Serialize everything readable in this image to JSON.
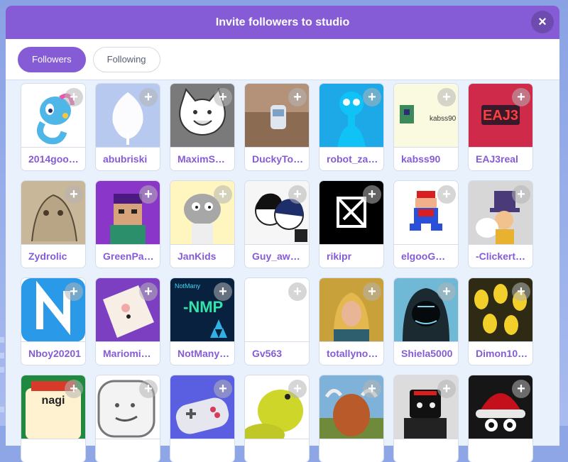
{
  "modal": {
    "title": "Invite followers to studio",
    "close_glyph": "×",
    "tabs": [
      {
        "label": "Followers",
        "active": true
      },
      {
        "label": "Following",
        "active": false
      }
    ]
  },
  "add_glyph": "+",
  "users": [
    {
      "name": "2014goo…",
      "avatar": "seahorse-dragon-icon"
    },
    {
      "name": "abubriski",
      "avatar": "leaf-silhouette-icon"
    },
    {
      "name": "MaximSc…",
      "avatar": "cat-face-icon"
    },
    {
      "name": "DuckyTo…",
      "avatar": "toy-car-photo-icon"
    },
    {
      "name": "robot_za…",
      "avatar": "blue-robot-icon"
    },
    {
      "name": "kabss90",
      "avatar": "kabss90-logo-icon"
    },
    {
      "name": "EAJ3real",
      "avatar": "eaj3-text-logo-icon"
    },
    {
      "name": "Zydrolic",
      "avatar": "sketch-character-icon"
    },
    {
      "name": "GreenPa…",
      "avatar": "pixel-character-icon"
    },
    {
      "name": "JanKids",
      "avatar": "cartoon-cat-icon"
    },
    {
      "name": "Guy_aw…",
      "avatar": "anime-faces-icon"
    },
    {
      "name": "rikipr",
      "avatar": "rk-logo-icon"
    },
    {
      "name": "elgooGm…",
      "avatar": "pixel-mario-icon"
    },
    {
      "name": "-Clickert…",
      "avatar": "hat-kid-icon"
    },
    {
      "name": "Nboy20201",
      "avatar": "n-logo-icon"
    },
    {
      "name": "Mariomi…",
      "avatar": "drawing-paper-icon"
    },
    {
      "name": "NotMany…",
      "avatar": "notmany-projects-icon"
    },
    {
      "name": "Gv563",
      "avatar": "blank-avatar-icon"
    },
    {
      "name": "totallyno…",
      "avatar": "link-portrait-icon"
    },
    {
      "name": "Shiela5000",
      "avatar": "hooded-figure-icon"
    },
    {
      "name": "Dimon10…",
      "avatar": "minions-crowd-icon"
    },
    {
      "name": "",
      "avatar": "nagi-avatar-icon",
      "thumb_text": "nagi"
    },
    {
      "name": "",
      "avatar": "smiley-face-icon"
    },
    {
      "name": "",
      "avatar": "gamepad-icon"
    },
    {
      "name": "",
      "avatar": "yellow-bird-icon"
    },
    {
      "name": "",
      "avatar": "highland-cow-icon"
    },
    {
      "name": "",
      "avatar": "black-robot-icon"
    },
    {
      "name": "",
      "avatar": "red-hat-character-icon"
    }
  ],
  "colors": {
    "accent": "#855cd6",
    "background": "#e9f1fc"
  }
}
